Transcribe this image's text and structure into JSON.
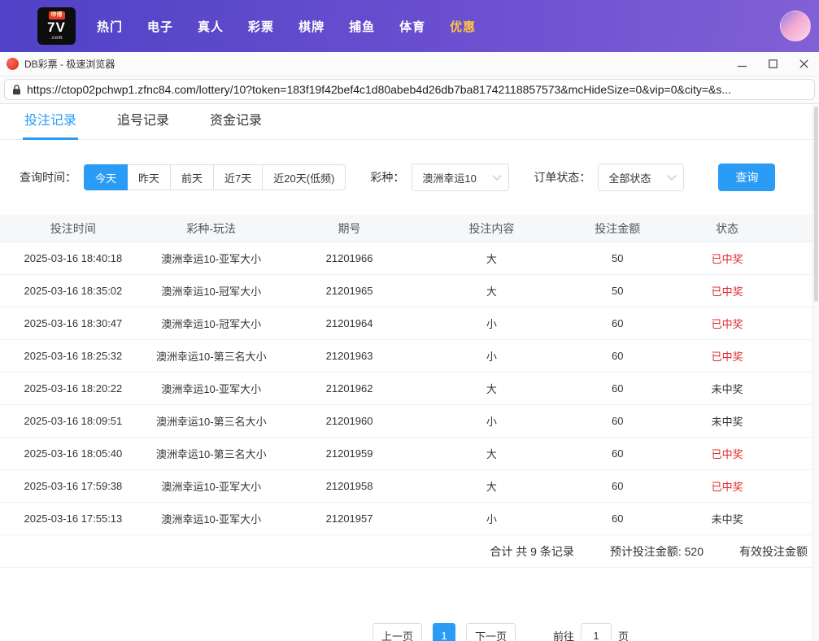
{
  "colors": {
    "accent": "#2b9cf5",
    "win_red": "#e22b2b",
    "nav_gradient_start": "#4f42c6",
    "nav_gradient_end": "#8260d6",
    "highlight_gold": "#ffc53d"
  },
  "icons": {
    "app-icon": "red-circle-logo",
    "lock-icon": "padlock",
    "minimize-icon": "line",
    "maximize-icon": "square",
    "close-icon": "cross",
    "chevron-down-icon": "caret-down"
  },
  "site": {
    "logo": {
      "badge": "申博",
      "main": "7V",
      "sub": ".com"
    },
    "nav": [
      {
        "label": "热门"
      },
      {
        "label": "电子"
      },
      {
        "label": "真人"
      },
      {
        "label": "彩票"
      },
      {
        "label": "棋牌"
      },
      {
        "label": "捕鱼"
      },
      {
        "label": "体育"
      },
      {
        "label": "优惠"
      }
    ]
  },
  "browser": {
    "title": "DB彩票 - 极速浏览器",
    "url": "https://ctop02pchwp1.zfnc84.com/lottery/10?token=183f19f42bef4c1d80abeb4d26db7ba81742118857573&mcHideSize=0&vip=0&city=&s..."
  },
  "tabs": [
    {
      "label": "投注记录"
    },
    {
      "label": "追号记录"
    },
    {
      "label": "资金记录"
    }
  ],
  "filters": {
    "time_label": "查询时间：",
    "time_options": [
      "今天",
      "昨天",
      "前天",
      "近7天",
      "近20天(低频)"
    ],
    "active_time": "今天",
    "lottery_label": "彩种：",
    "lottery_value": "澳洲幸运10",
    "status_label": "订单状态：",
    "status_value": "全部状态",
    "query_label": "查询"
  },
  "table": {
    "headers": [
      "投注时间",
      "彩种-玩法",
      "期号",
      "投注内容",
      "投注金额",
      "状态"
    ],
    "win_status": "已中奖",
    "rows": [
      {
        "time": "2025-03-16 18:40:18",
        "game": "澳洲幸运10-亚军大小",
        "issue": "21201966",
        "content": "大",
        "amount": "50",
        "status": "已中奖"
      },
      {
        "time": "2025-03-16 18:35:02",
        "game": "澳洲幸运10-冠军大小",
        "issue": "21201965",
        "content": "大",
        "amount": "50",
        "status": "已中奖"
      },
      {
        "time": "2025-03-16 18:30:47",
        "game": "澳洲幸运10-冠军大小",
        "issue": "21201964",
        "content": "小",
        "amount": "60",
        "status": "已中奖"
      },
      {
        "time": "2025-03-16 18:25:32",
        "game": "澳洲幸运10-第三名大小",
        "issue": "21201963",
        "content": "小",
        "amount": "60",
        "status": "已中奖"
      },
      {
        "time": "2025-03-16 18:20:22",
        "game": "澳洲幸运10-亚军大小",
        "issue": "21201962",
        "content": "大",
        "amount": "60",
        "status": "未中奖"
      },
      {
        "time": "2025-03-16 18:09:51",
        "game": "澳洲幸运10-第三名大小",
        "issue": "21201960",
        "content": "小",
        "amount": "60",
        "status": "未中奖"
      },
      {
        "time": "2025-03-16 18:05:40",
        "game": "澳洲幸运10-第三名大小",
        "issue": "21201959",
        "content": "大",
        "amount": "60",
        "status": "已中奖"
      },
      {
        "time": "2025-03-16 17:59:38",
        "game": "澳洲幸运10-亚军大小",
        "issue": "21201958",
        "content": "大",
        "amount": "60",
        "status": "已中奖"
      },
      {
        "time": "2025-03-16 17:55:13",
        "game": "澳洲幸运10-亚军大小",
        "issue": "21201957",
        "content": "小",
        "amount": "60",
        "status": "未中奖"
      }
    ],
    "summary": {
      "total_label": "合计 共 9 条记录",
      "expected_label": "预计投注金额: 520",
      "valid_label": "有效投注金额"
    }
  },
  "pagination": {
    "prev_label": "上一页",
    "current_page": "1",
    "next_label": "下一页",
    "goto_label": "前往",
    "goto_value": "1",
    "page_unit": "页"
  }
}
